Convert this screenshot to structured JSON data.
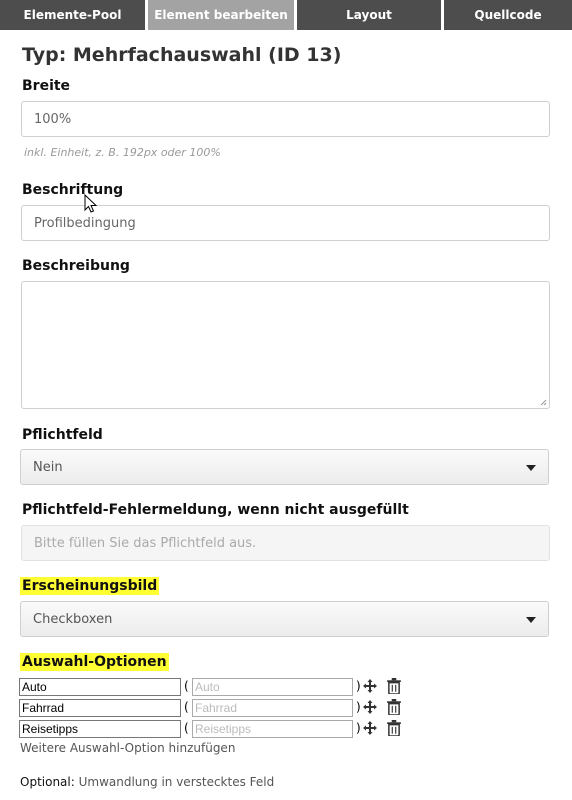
{
  "tabs": [
    {
      "label": "Elemente-Pool",
      "active": false
    },
    {
      "label": "Element bearbeiten",
      "active": true
    },
    {
      "label": "Layout",
      "active": false
    },
    {
      "label": "Quellcode",
      "active": false
    }
  ],
  "title": "Typ: Mehrfachauswahl (ID 13)",
  "breite": {
    "label": "Breite",
    "value": "100%",
    "hint": "inkl. Einheit, z. B. 192px oder 100%"
  },
  "beschriftung": {
    "label": "Beschriftung",
    "value": "Profilbedingung"
  },
  "beschreibung": {
    "label": "Beschreibung",
    "value": ""
  },
  "pflichtfeld": {
    "label": "Pflichtfeld",
    "selected": "Nein"
  },
  "fehlermeldung": {
    "label": "Pflichtfeld-Fehlermeldung, wenn nicht ausgefüllt",
    "placeholder": "Bitte füllen Sie das Pflichtfeld aus."
  },
  "erscheinungsbild": {
    "label": "Erscheinungsbild",
    "selected": "Checkboxen"
  },
  "optionen": {
    "label": "Auswahl-Optionen",
    "items": [
      {
        "value": "Auto",
        "placeholder": "Auto"
      },
      {
        "value": "Fahrrad",
        "placeholder": "Fahrrad"
      },
      {
        "value": "Reisetipps",
        "placeholder": "Reisetipps"
      }
    ],
    "add_link": "Weitere Auswahl-Option hinzufügen"
  },
  "optional": {
    "prefix": "Optional:",
    "link": "Umwandlung in verstecktes Feld"
  },
  "colors": {
    "tab_bg": "#4d4d4d",
    "tab_active_bg": "#a3a3a3",
    "highlight": "#ffff33"
  },
  "icons": {
    "move": "move-icon",
    "delete": "trash-icon"
  }
}
